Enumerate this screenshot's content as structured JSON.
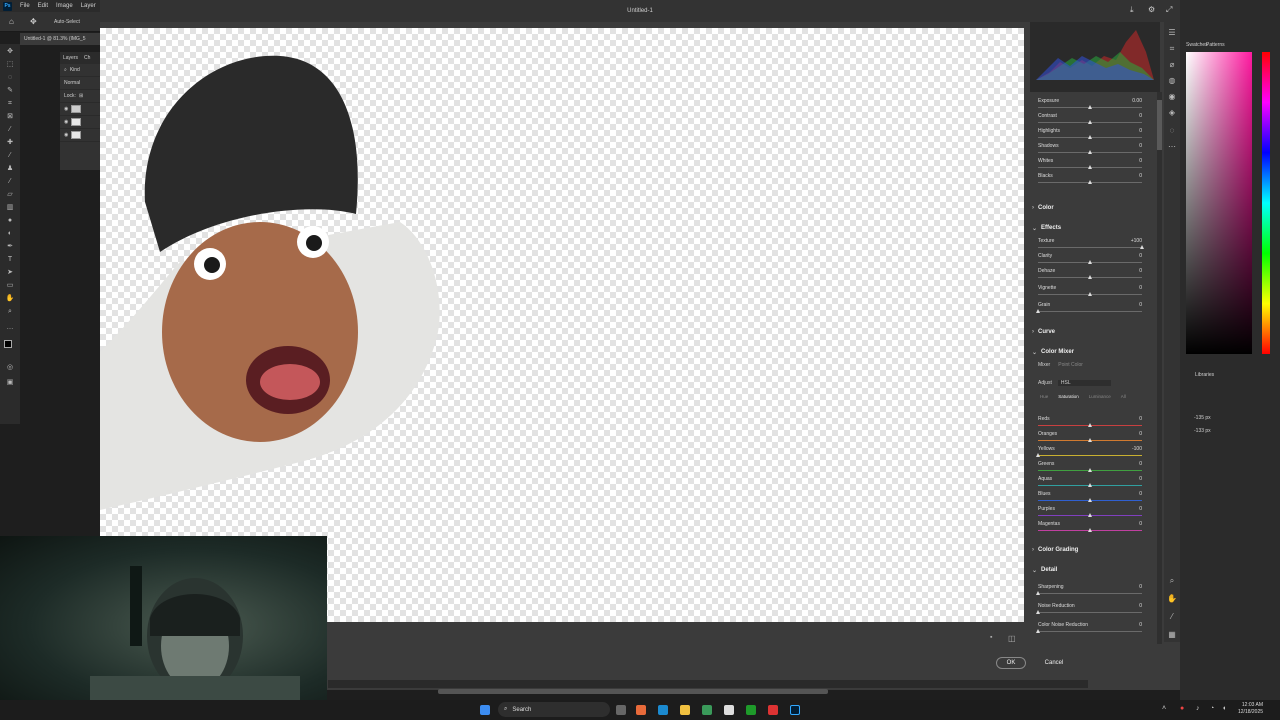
{
  "menubar": {
    "items": [
      "File",
      "Edit",
      "Image",
      "Layer",
      "Ty"
    ]
  },
  "optbar": {
    "autoselect": "Auto-Select"
  },
  "doc_tab": "Untitled-1 @ 81.3% (IMG_5",
  "layers_panel": {
    "tabs": [
      "Layers",
      "Ch"
    ],
    "kind": "Kind",
    "blend": "Normal",
    "lock": "Lock:"
  },
  "dialog": {
    "title": "Untitled-1"
  },
  "basic": [
    {
      "label": "Exposure",
      "value": "0.00",
      "pos": 0.5
    },
    {
      "label": "Contrast",
      "value": "0",
      "pos": 0.5
    },
    {
      "label": "Highlights",
      "value": "0",
      "pos": 0.5
    },
    {
      "label": "Shadows",
      "value": "0",
      "pos": 0.5
    },
    {
      "label": "Whites",
      "value": "0",
      "pos": 0.5
    },
    {
      "label": "Blacks",
      "value": "0",
      "pos": 0.5
    }
  ],
  "sections": {
    "color": "Color",
    "effects": "Effects",
    "curve": "Curve",
    "color_mixer": "Color Mixer",
    "color_grading": "Color Grading",
    "detail": "Detail"
  },
  "effects": [
    {
      "label": "Texture",
      "value": "+100",
      "pos": 1.0
    },
    {
      "label": "Clarity",
      "value": "0",
      "pos": 0.5
    },
    {
      "label": "Dehaze",
      "value": "0",
      "pos": 0.5
    },
    {
      "label": "Vignette",
      "value": "0",
      "pos": 0.5
    },
    {
      "label": "Grain",
      "value": "0",
      "pos": 0.0
    }
  ],
  "mixer": {
    "tabs": [
      "Mixer",
      "Point Color"
    ],
    "adjust_label": "Adjust",
    "adjust_value": "HSL",
    "subtabs": [
      "Hue",
      "Saturation",
      "Luminance",
      "All"
    ],
    "rows": [
      {
        "label": "Reds",
        "value": "0",
        "pos": 0.5
      },
      {
        "label": "Oranges",
        "value": "0",
        "pos": 0.5
      },
      {
        "label": "Yellows",
        "value": "-100",
        "pos": 0.0
      },
      {
        "label": "Greens",
        "value": "0",
        "pos": 0.5
      },
      {
        "label": "Aquas",
        "value": "0",
        "pos": 0.5
      },
      {
        "label": "Blues",
        "value": "0",
        "pos": 0.5
      },
      {
        "label": "Purples",
        "value": "0",
        "pos": 0.5
      },
      {
        "label": "Magentas",
        "value": "0",
        "pos": 0.5
      }
    ]
  },
  "detail": [
    {
      "label": "Sharpening",
      "value": "0",
      "pos": 0.0
    },
    {
      "label": "Noise Reduction",
      "value": "0",
      "pos": 0.0
    },
    {
      "label": "Color Noise Reduction",
      "value": "0",
      "pos": 0.0
    }
  ],
  "buttons": {
    "ok": "OK",
    "cancel": "Cancel"
  },
  "right_panel": {
    "tabs": [
      "Swatches",
      "Patterns"
    ],
    "libraries": "Libraries",
    "x": "-135 px",
    "y": "-133 px"
  },
  "taskbar": {
    "search": "Search",
    "time": "12:03 AM",
    "date": "12/18/2025"
  },
  "colors": {
    "accent": "#31a8ff",
    "mixer_track_reds": "#c84040"
  }
}
